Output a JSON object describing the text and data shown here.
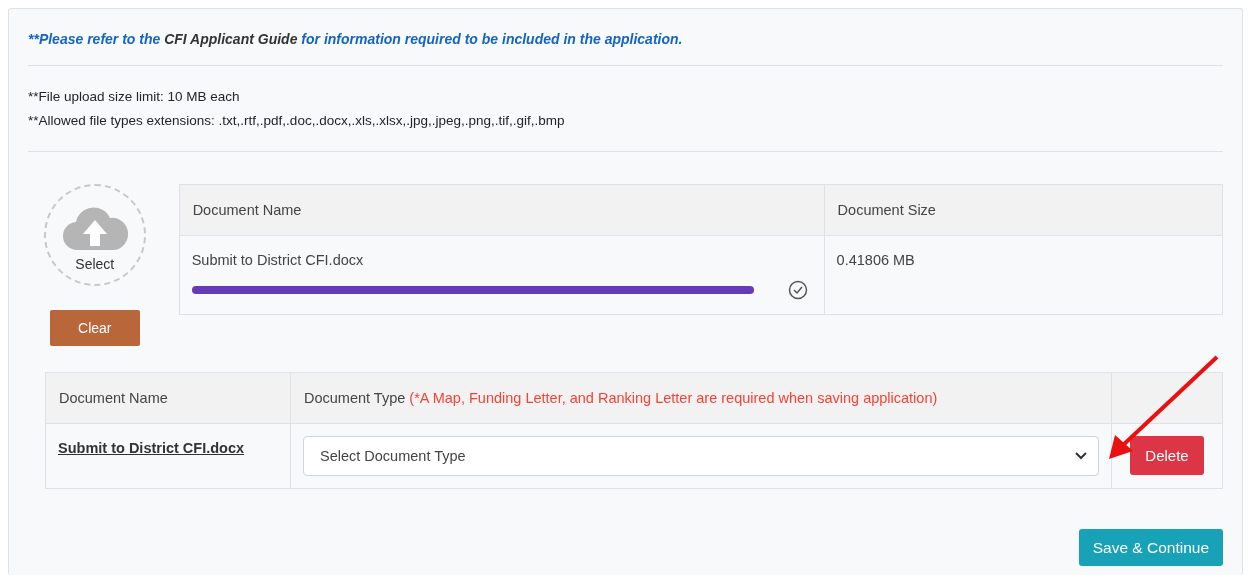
{
  "notice": {
    "prefix": "**Please refer to the ",
    "link": "CFI Applicant Guide",
    "suffix": " for information required to be included in the application."
  },
  "limits": [
    "**File upload size limit: 10 MB each",
    "**Allowed file types extensions: .txt,.rtf,.pdf,.doc,.docx,.xls,.xlsx,.jpg,.jpeg,.png,.tif,.gif,.bmp"
  ],
  "uploader": {
    "select_label": "Select",
    "clear_button": "Clear"
  },
  "upload_table": {
    "columns": [
      "Document Name",
      "Document Size"
    ],
    "rows": [
      {
        "name": "Submit to District CFI.docx",
        "level": 1,
        "complete": true,
        "size": "0.41806 MB"
      }
    ]
  },
  "documents_table": {
    "columns": [
      {
        "label": "Document Name"
      },
      {
        "label": "Document Type",
        "note": "(*A Map, Funding Letter, and Ranking Letter are required when saving application)"
      }
    ],
    "rows": [
      {
        "name": "Submit to District CFI.docx",
        "type_placeholder": "Select Document Type",
        "delete_button": "Delete"
      }
    ]
  },
  "annotation": {
    "kind": "arrow"
  },
  "save_button": "Save & Continue"
}
